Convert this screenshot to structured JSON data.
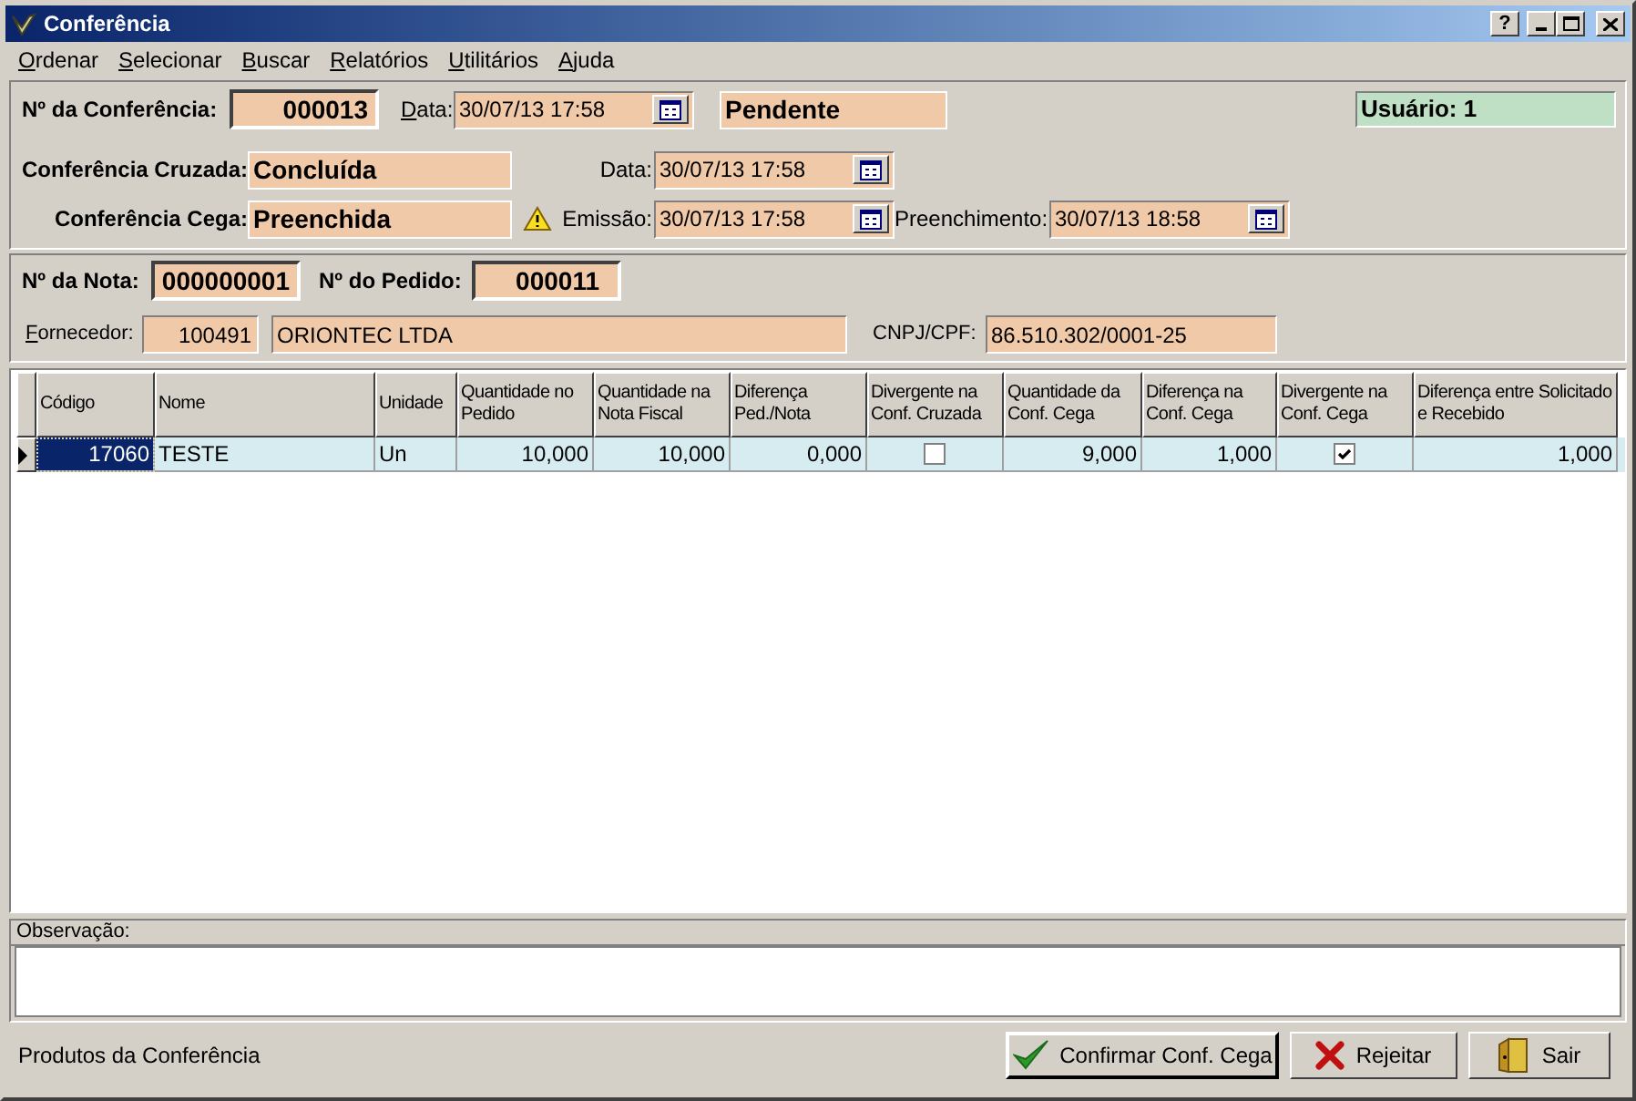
{
  "window": {
    "title": "Conferência",
    "help_button": "?"
  },
  "menu": [
    {
      "label": "Ordenar"
    },
    {
      "label": "Selecionar"
    },
    {
      "label": "Buscar"
    },
    {
      "label": "Relatórios"
    },
    {
      "label": "Utilitários"
    },
    {
      "label": "Ajuda"
    }
  ],
  "header": {
    "numero": {
      "label": "Nº da Conferência:",
      "value": "000013"
    },
    "data": {
      "label": "Data:",
      "value": "30/07/13 17:58"
    },
    "status": "Pendente",
    "usuario": "Usuário: 1",
    "cruzada": {
      "label": "Conferência Cruzada:",
      "value": "Concluída",
      "data_label": "Data:",
      "data": "30/07/13 17:58"
    },
    "cega": {
      "label": "Conferência Cega:",
      "value": "Preenchida",
      "warning": true,
      "emissao_label": "Emissão:",
      "emissao": "30/07/13 17:58",
      "preenchimento_label": "Preenchimento:",
      "preenchimento": "30/07/13 18:58"
    }
  },
  "nota": {
    "numero": {
      "label": "Nº da Nota:",
      "value": "000000001"
    },
    "pedido": {
      "label": "Nº do Pedido:",
      "value": "000011"
    },
    "fornecedor": {
      "label": "Fornecedor:",
      "code": "100491",
      "name": "ORIONTEC LTDA"
    },
    "cnpj": {
      "label": "CNPJ/CPF:",
      "value": "86.510.302/0001-25"
    }
  },
  "table": {
    "columns": [
      "Código",
      "Nome",
      "Unidade",
      "Quantidade no Pedido",
      "Quantidade na Nota Fiscal",
      "Diferença Ped./Nota",
      "Divergente na Conf. Cruzada",
      "Quantidade da Conf. Cega",
      "Diferença na Conf. Cega",
      "Divergente na Conf. Cega",
      "Diferença entre Solicitado e Recebido"
    ],
    "rows": [
      {
        "selected": true,
        "cells": [
          {
            "kind": "number",
            "text": "17060",
            "focused": true
          },
          {
            "kind": "text",
            "text": "TESTE"
          },
          {
            "kind": "text",
            "text": "Un"
          },
          {
            "kind": "number",
            "text": "10,000"
          },
          {
            "kind": "number",
            "text": "10,000"
          },
          {
            "kind": "number",
            "text": "0,000"
          },
          {
            "kind": "checkbox",
            "checked": false
          },
          {
            "kind": "number",
            "text": "9,000"
          },
          {
            "kind": "number",
            "text": "1,000"
          },
          {
            "kind": "checkbox",
            "checked": true
          },
          {
            "kind": "number",
            "text": "1,000"
          }
        ]
      }
    ]
  },
  "observacao": {
    "label": "Observação:"
  },
  "status_bar": "Produtos da Conferência",
  "buttons": [
    {
      "kind": "confirm",
      "label": "Confirmar Conf. Cega"
    },
    {
      "kind": "reject",
      "label": "Rejeitar"
    },
    {
      "kind": "exit",
      "label": "Sair"
    }
  ]
}
